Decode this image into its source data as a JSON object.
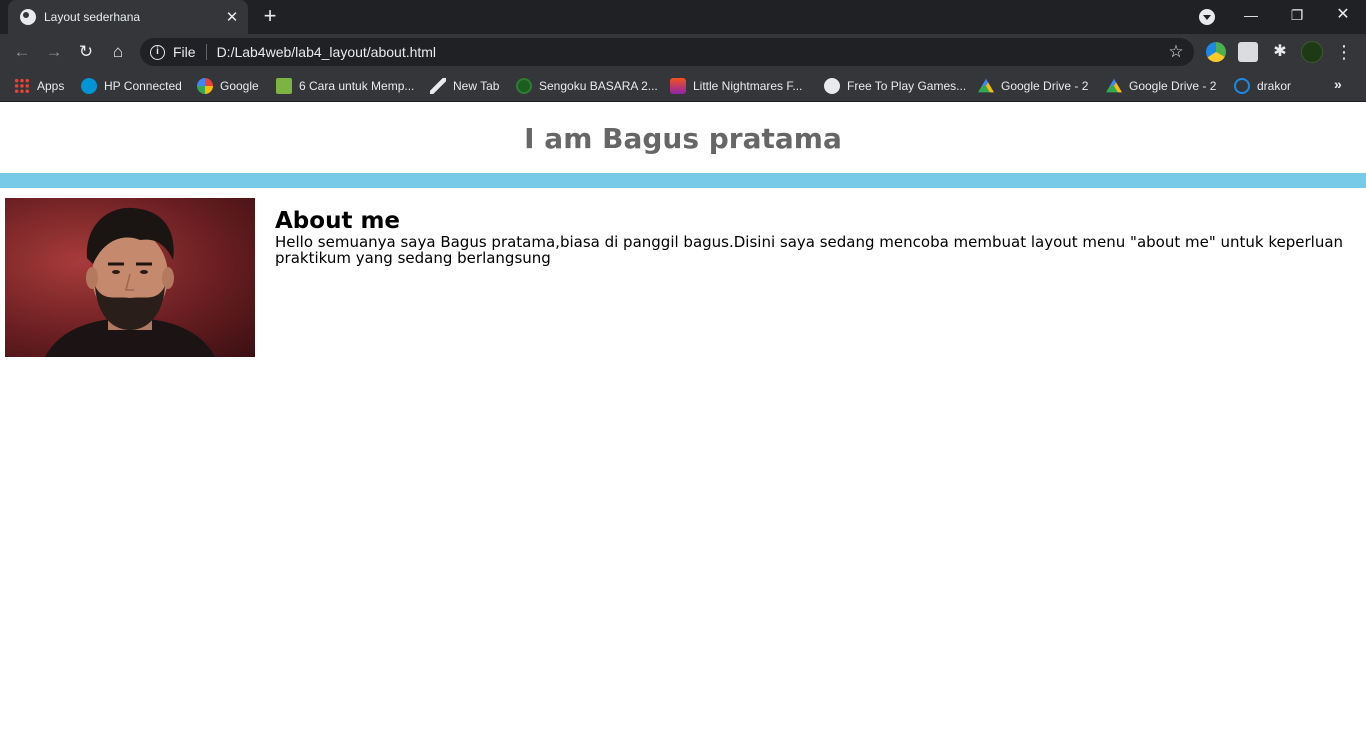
{
  "browser": {
    "tab": {
      "title": "Layout sederhana"
    },
    "toolbar": {
      "scheme": "File",
      "url": "D:/Lab4web/lab4_layout/about.html"
    },
    "bookmarks": [
      {
        "label": "Apps",
        "icon": "apps-grid-icon"
      },
      {
        "label": "HP Connected",
        "icon": "hp-icon"
      },
      {
        "label": "Google",
        "icon": "google-icon"
      },
      {
        "label": "6 Cara untuk Memp...",
        "icon": "wikihow-icon"
      },
      {
        "label": "New Tab",
        "icon": "new-tab-icon"
      },
      {
        "label": "Sengoku BASARA 2...",
        "icon": "sengoku-icon"
      },
      {
        "label": "Little Nightmares F...",
        "icon": "little-nightmares-icon"
      },
      {
        "label": "Free To Play Games...",
        "icon": "steam-icon"
      },
      {
        "label": "Google Drive - 2",
        "icon": "google-drive-icon"
      },
      {
        "label": "Google Drive - 2",
        "icon": "google-drive-icon"
      },
      {
        "label": "drakor",
        "icon": "drakor-icon"
      }
    ]
  },
  "page": {
    "header_title": "I am Bagus pratama",
    "accent_bar_color": "#77cbe9",
    "about": {
      "title": "About me",
      "body": "Hello semuanya saya Bagus pratama,biasa di panggil bagus.Disini saya sedang mencoba membuat layout menu \"about me\" untuk keperluan praktikum yang sedang berlangsung"
    }
  }
}
